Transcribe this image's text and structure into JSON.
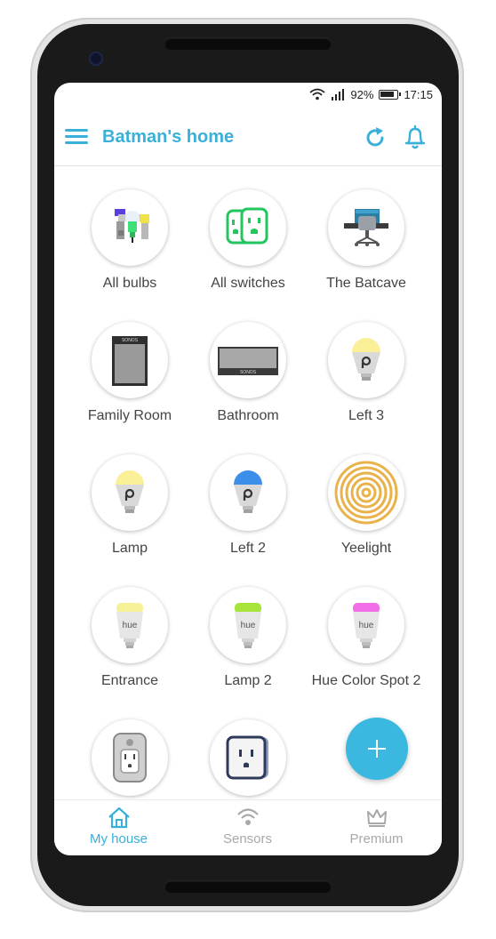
{
  "status_bar": {
    "battery": "92%",
    "time": "17:15"
  },
  "header": {
    "title": "Batman's home"
  },
  "devices": [
    {
      "label": "All bulbs",
      "icon": "bulbs-group-icon"
    },
    {
      "label": "All switches",
      "icon": "switches-group-icon"
    },
    {
      "label": "The Batcave",
      "icon": "room-chair-icon"
    },
    {
      "label": "Family Room",
      "icon": "sonos-speaker-icon"
    },
    {
      "label": "Bathroom",
      "icon": "sonos-soundbar-icon"
    },
    {
      "label": "Left 3",
      "icon": "tplink-bulb-icon"
    },
    {
      "label": "Lamp",
      "icon": "tplink-bulb-icon"
    },
    {
      "label": "Left 2",
      "icon": "tplink-bulb-icon"
    },
    {
      "label": "Yeelight",
      "icon": "light-strip-icon"
    },
    {
      "label": "Entrance",
      "icon": "hue-bulb-icon"
    },
    {
      "label": "Lamp 2",
      "icon": "hue-bulb-icon"
    },
    {
      "label": "Hue Color Spot 2",
      "icon": "hue-bulb-icon"
    },
    {
      "label": "",
      "icon": "smart-plug-icon"
    },
    {
      "label": "",
      "icon": "smart-outlet-icon"
    }
  ],
  "colors": {
    "accent": "#3ab0d9",
    "left3_bulb": "#fbf097",
    "lamp_bulb": "#fbf097",
    "left2_bulb": "#3b8fe8",
    "entrance_bulb": "#f7f199",
    "lamp2_bulb": "#a6e33b",
    "hue_spot2_bulb": "#f26ee6"
  },
  "bulb_brand_text": {
    "hue": "hue",
    "sonos": "SONOS"
  },
  "nav": {
    "my_house": "My house",
    "sensors": "Sensors",
    "premium": "Premium"
  }
}
